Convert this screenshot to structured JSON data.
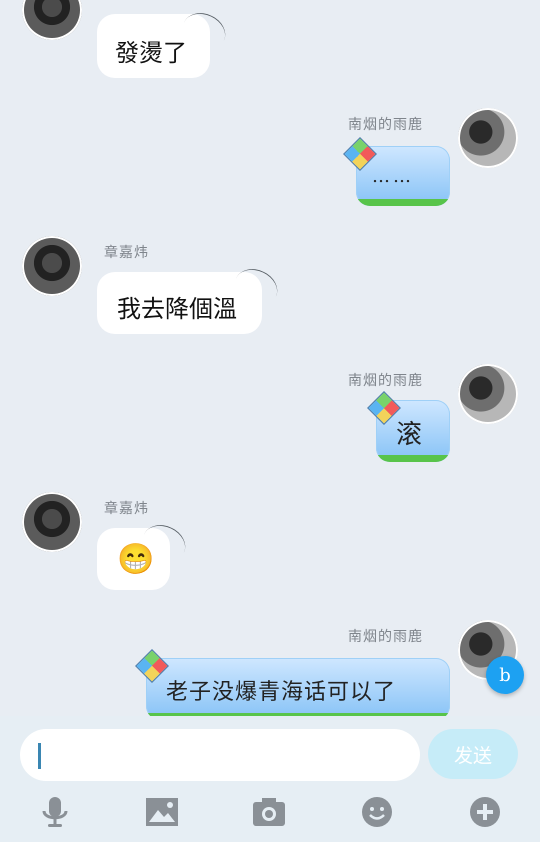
{
  "messages": [
    {
      "side": "left",
      "name": "",
      "text": "發燙了"
    },
    {
      "side": "right",
      "name": "南烟的雨鹿",
      "text": "……"
    },
    {
      "side": "left",
      "name": "章嘉炜",
      "text": "我去降個溫"
    },
    {
      "side": "right",
      "name": "南烟的雨鹿",
      "text": "滚"
    },
    {
      "side": "left",
      "name": "章嘉炜",
      "text": "😁"
    },
    {
      "side": "right",
      "name": "南烟的雨鹿",
      "text": "老子没爆青海话可以了"
    }
  ],
  "input": {
    "value": "",
    "send_label": "发送"
  },
  "toolbar": [
    "mic-icon",
    "image-icon",
    "camera-icon",
    "emoji-icon",
    "plus-icon"
  ],
  "badge": {
    "label": "b"
  },
  "colors": {
    "background": "#e8edf3",
    "bubble_right": "#86c2f6",
    "send": "#c6ecf8",
    "badge": "#1da1f2"
  }
}
